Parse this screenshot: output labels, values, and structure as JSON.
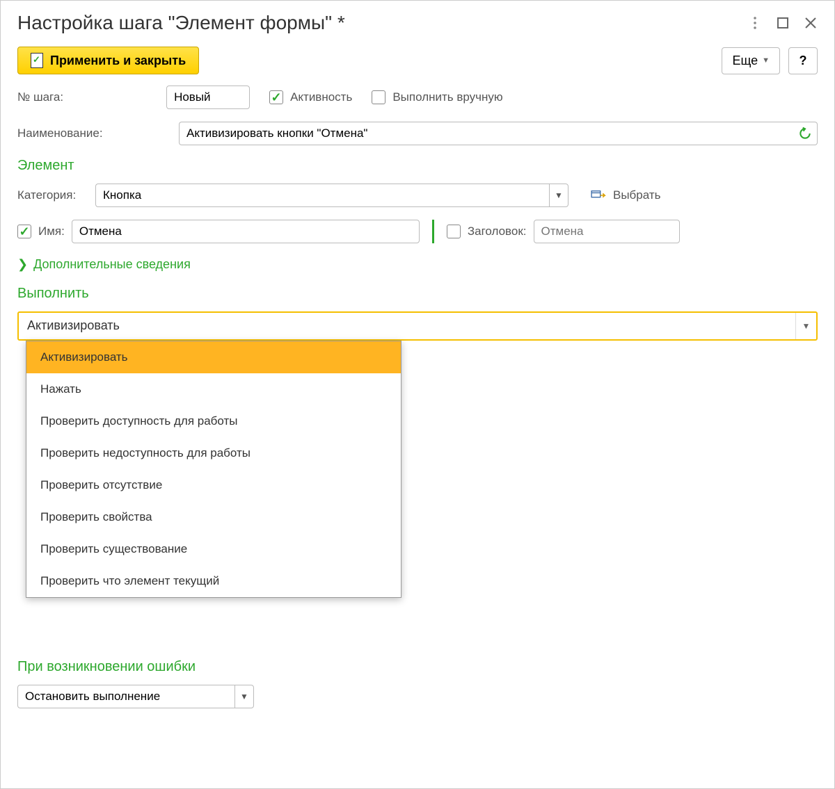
{
  "title": "Настройка шага \"Элемент формы\" *",
  "toolbar": {
    "apply_close": "Применить и закрыть",
    "more": "Еще",
    "help": "?"
  },
  "step": {
    "number_label": "№ шага:",
    "number_value": "Новый",
    "active_label": "Активность",
    "active_checked": true,
    "manual_label": "Выполнить вручную",
    "manual_checked": false
  },
  "name": {
    "label": "Наименование:",
    "value": "Активизировать кнопки \"Отмена\""
  },
  "element": {
    "section": "Элемент",
    "category_label": "Категория:",
    "category_value": "Кнопка",
    "choose_label": "Выбрать",
    "name_checked": true,
    "name_label": "Имя:",
    "name_value": "Отмена",
    "title_checked": false,
    "title_label": "Заголовок:",
    "title_placeholder": "Отмена"
  },
  "more_info": "Дополнительные сведения",
  "execute": {
    "section": "Выполнить",
    "value": "Активизировать",
    "options": [
      "Активизировать",
      "Нажать",
      "Проверить доступность для работы",
      "Проверить недоступность для работы",
      "Проверить отсутствие",
      "Проверить свойства",
      "Проверить существование",
      "Проверить что элемент текущий"
    ]
  },
  "on_error": {
    "section": "При возникновении ошибки",
    "value": "Остановить выполнение"
  }
}
